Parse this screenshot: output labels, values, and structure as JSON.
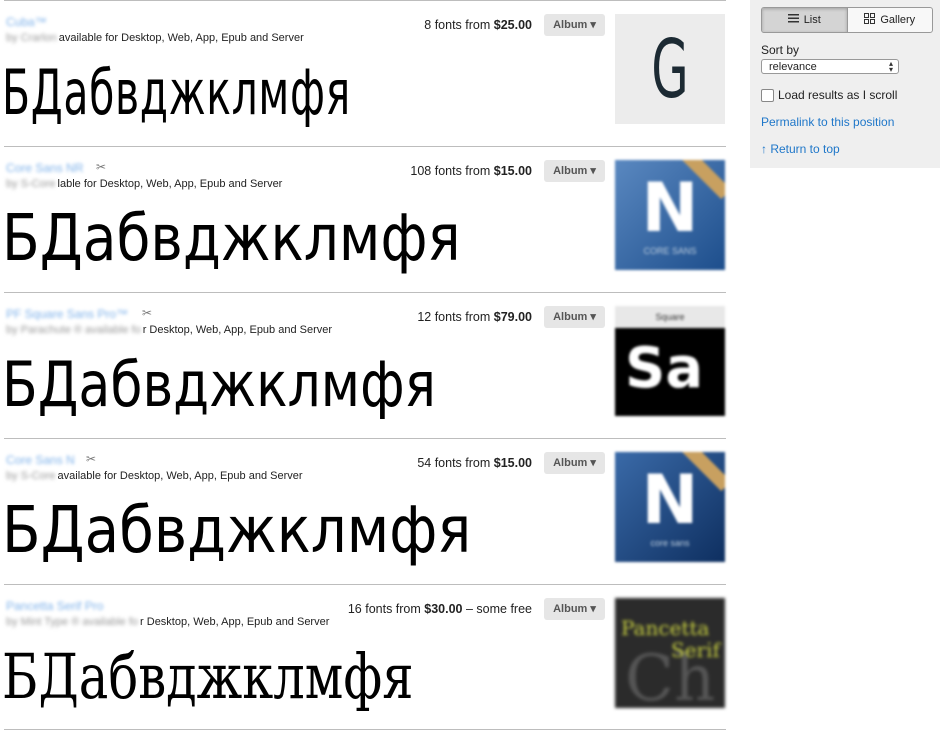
{
  "sample_text": "БДабвджклмфя",
  "album_label": "Album ▾",
  "results": [
    {
      "name": "Cuba™",
      "byline_prefix": "by Crarlon",
      "byline": "available for Desktop, Web, App, Epub and Server",
      "count": "8 fonts from ",
      "price": "$25.00",
      "extra": "",
      "thumb_text": "G"
    },
    {
      "name": "Core Sans NR",
      "byline_prefix": "by S-Core",
      "byline": "lable for Desktop, Web, App, Epub and Server",
      "count": "108 fonts from ",
      "price": "$15.00",
      "extra": "",
      "thumb_text": "N",
      "thumb_sub": "CORE SANS"
    },
    {
      "name": "PF Square Sans Pro™",
      "byline_prefix": "by Parachute ® available fo",
      "byline": "r Desktop, Web, App, Epub and Server",
      "count": "12 fonts from ",
      "price": "$79.00",
      "extra": "",
      "thumb_text": "Sa",
      "thumb_top": "Square"
    },
    {
      "name": "Core Sans N",
      "byline_prefix": "by S-Core",
      "byline": "available for Desktop, Web, App, Epub and Server",
      "count": "54 fonts from ",
      "price": "$15.00",
      "extra": "",
      "thumb_text": "N",
      "thumb_sub": "core sans"
    },
    {
      "name": "Pancetta Serif Pro",
      "byline_prefix": "by Mint Type ® available fo",
      "byline": "r Desktop, Web, App, Epub and Server",
      "count": "16 fonts from ",
      "price": "$30.00",
      "extra": " – some free",
      "thumb_text": "Pancetta",
      "thumb_text2": "Serif"
    }
  ],
  "sidebar": {
    "list_label": "List",
    "gallery_label": "Gallery",
    "sort_label": "Sort by",
    "sort_value": "relevance",
    "load_label": "Load results as I scroll",
    "permalink": "Permalink to this position",
    "return_top": "↑ Return to top"
  }
}
